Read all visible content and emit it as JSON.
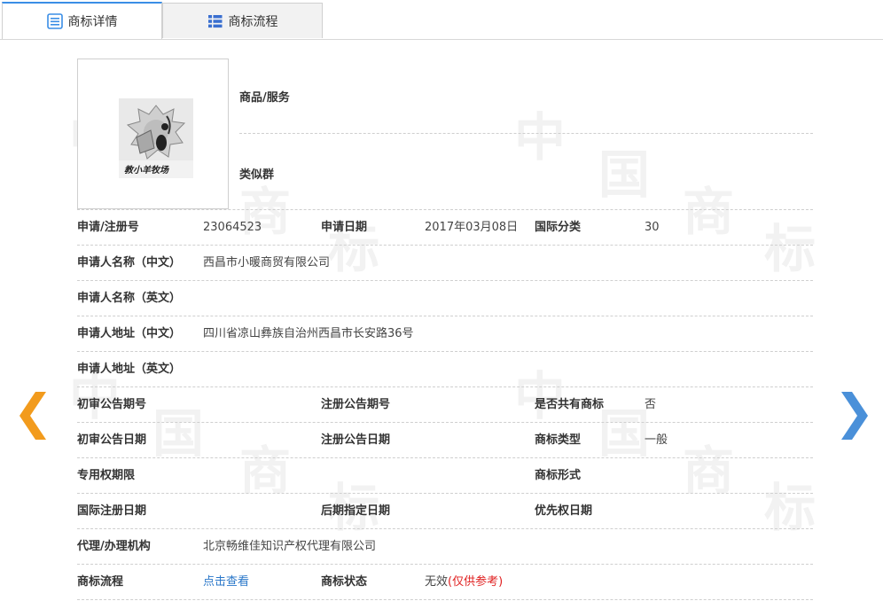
{
  "tabs": [
    {
      "label": "商标详情",
      "active": true,
      "icon": "document-list-icon"
    },
    {
      "label": "商标流程",
      "active": false,
      "icon": "list-icon"
    }
  ],
  "watermark": {
    "chars": [
      "中",
      "国",
      "商",
      "标"
    ]
  },
  "trademark_image": {
    "caption": "教小羊牧场",
    "icon": "trademark-logo-image"
  },
  "goods_services": {
    "label": "商品/服务",
    "value": ""
  },
  "similar_group": {
    "label": "类似群",
    "value": ""
  },
  "rows": {
    "reg_no": {
      "label": "申请/注册号",
      "value": "23064523"
    },
    "app_date": {
      "label": "申请日期",
      "value": "2017年03月08日"
    },
    "intl_class": {
      "label": "国际分类",
      "value": "30"
    },
    "applicant_cn": {
      "label": "申请人名称（中文）",
      "value": "西昌市小暖商贸有限公司"
    },
    "applicant_en": {
      "label": "申请人名称（英文）",
      "value": ""
    },
    "address_cn": {
      "label": "申请人地址（中文）",
      "value": "四川省凉山彝族自治州西昌市长安路36号"
    },
    "address_en": {
      "label": "申请人地址（英文）",
      "value": ""
    },
    "prelim_no": {
      "label": "初审公告期号",
      "value": ""
    },
    "reg_pub_no": {
      "label": "注册公告期号",
      "value": ""
    },
    "shared": {
      "label": "是否共有商标",
      "value": "否"
    },
    "prelim_date": {
      "label": "初审公告日期",
      "value": ""
    },
    "reg_pub_date": {
      "label": "注册公告日期",
      "value": ""
    },
    "tm_type": {
      "label": "商标类型",
      "value": "一般"
    },
    "exclusive_period": {
      "label": "专用权期限",
      "value": ""
    },
    "tm_form": {
      "label": "商标形式",
      "value": ""
    },
    "intl_reg_date": {
      "label": "国际注册日期",
      "value": ""
    },
    "later_date": {
      "label": "后期指定日期",
      "value": ""
    },
    "priority_date": {
      "label": "优先权日期",
      "value": ""
    },
    "agent": {
      "label": "代理/办理机构",
      "value": "北京畅维佳知识产权代理有限公司"
    },
    "process": {
      "label": "商标流程",
      "value": "点击查看"
    },
    "status": {
      "label": "商标状态",
      "value": "无效",
      "note": "(仅供参考)"
    }
  },
  "nav": {
    "prev_icon": "chevron-left-icon",
    "next_icon": "chevron-right-icon"
  },
  "colors": {
    "accent": "#3a8ee6",
    "prev_arrow": "#f29b1d",
    "next_arrow": "#4a90d9",
    "status_note": "#e02020",
    "link": "#2a77c9"
  }
}
